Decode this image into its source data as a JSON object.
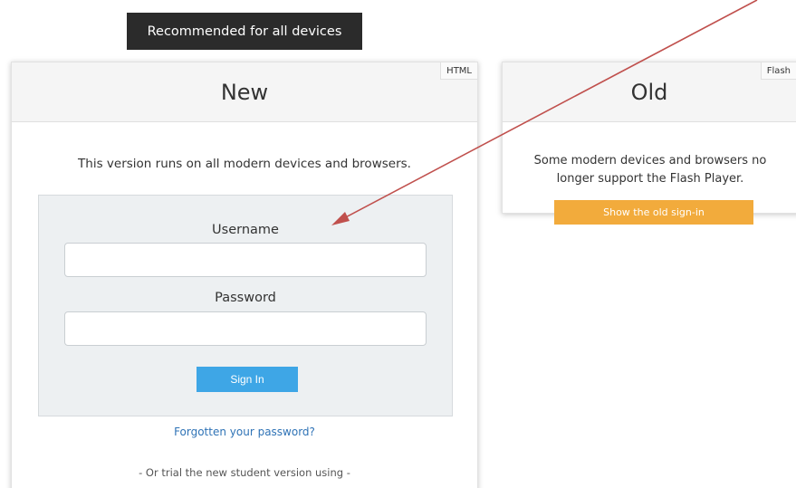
{
  "banner": {
    "text": "Recommended for all devices"
  },
  "new_panel": {
    "title": "New",
    "tag": "HTML",
    "description": "This version runs on all modern devices and browsers.",
    "username_label": "Username",
    "username_value": "",
    "password_label": "Password",
    "password_value": "",
    "signin_label": "Sign In",
    "forgot_link": "Forgotten your password?",
    "trial_text": "- Or trial the new student version using -"
  },
  "old_panel": {
    "title": "Old",
    "tag": "Flash",
    "description_line1": "Some modern devices and browsers no",
    "description_line2": "longer support the Flash Player.",
    "button_label": "Show the old sign-in"
  },
  "colors": {
    "banner_bg": "#2b2b2b",
    "signin_button": "#3ea6e6",
    "old_button": "#f2ab3c",
    "link": "#2f73b6",
    "annotation_arrow": "#c0504d"
  }
}
